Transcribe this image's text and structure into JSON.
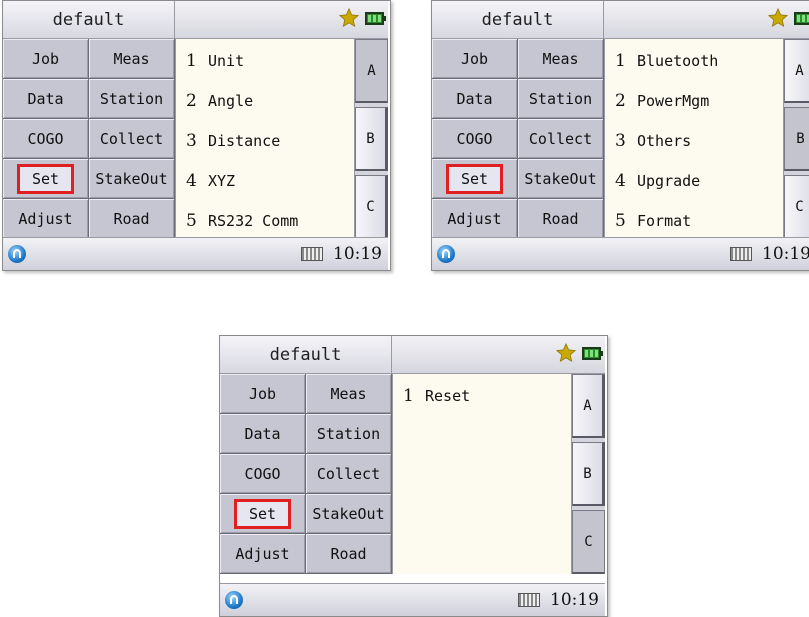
{
  "screens": [
    {
      "profile": "default",
      "menu": [
        "Job",
        "Meas",
        "Data",
        "Station",
        "COGO",
        "Collect",
        "Set",
        "StakeOut",
        "Adjust",
        "Road"
      ],
      "list": [
        {
          "num": "1",
          "label": "Unit"
        },
        {
          "num": "2",
          "label": "Angle"
        },
        {
          "num": "3",
          "label": "Distance"
        },
        {
          "num": "4",
          "label": "XYZ"
        },
        {
          "num": "5",
          "label": "RS232 Comm"
        }
      ],
      "tabs": [
        "A",
        "B",
        "C"
      ],
      "active_tab": "A",
      "time": "10:19"
    },
    {
      "profile": "default",
      "menu": [
        "Job",
        "Meas",
        "Data",
        "Station",
        "COGO",
        "Collect",
        "Set",
        "StakeOut",
        "Adjust",
        "Road"
      ],
      "list": [
        {
          "num": "1",
          "label": "Bluetooth"
        },
        {
          "num": "2",
          "label": "PowerMgm"
        },
        {
          "num": "3",
          "label": "Others"
        },
        {
          "num": "4",
          "label": "Upgrade"
        },
        {
          "num": "5",
          "label": "Format"
        }
      ],
      "tabs": [
        "A",
        "B",
        "C"
      ],
      "active_tab": "B",
      "time": "10:19"
    },
    {
      "profile": "default",
      "menu": [
        "Job",
        "Meas",
        "Data",
        "Station",
        "COGO",
        "Collect",
        "Set",
        "StakeOut",
        "Adjust",
        "Road"
      ],
      "list": [
        {
          "num": "1",
          "label": "Reset"
        }
      ],
      "tabs": [
        "A",
        "B",
        "C"
      ],
      "active_tab": "C",
      "time": "10:19"
    }
  ],
  "highlighted_menu": "Set",
  "icons": {
    "favorite": "star-icon",
    "battery": "battery-icon",
    "start": "start-icon",
    "keyboard": "keyboard-icon"
  },
  "colors": {
    "highlight": "#e02020",
    "list_bg": "#fdfbef",
    "button_bg": "#c6c6d2",
    "star": "#c9a800"
  }
}
